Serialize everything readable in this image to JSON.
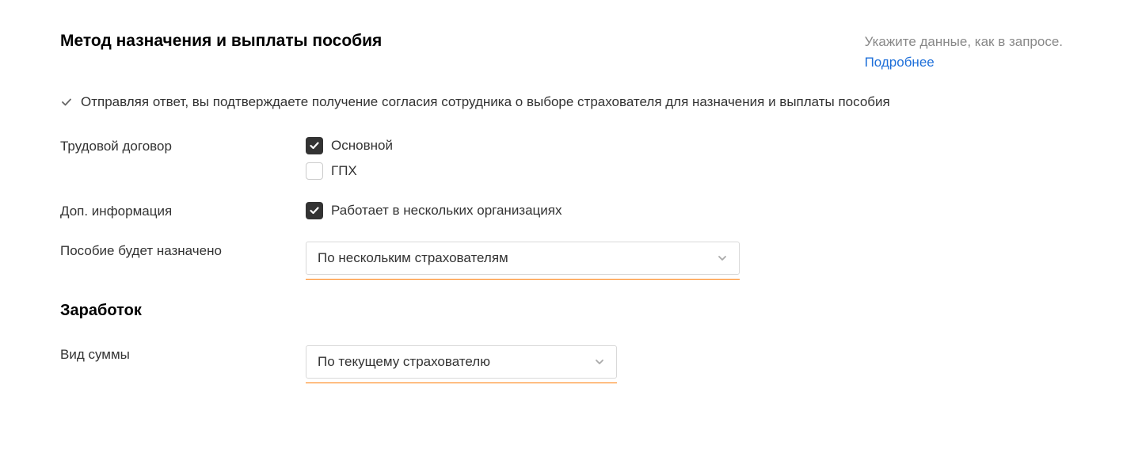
{
  "header": {
    "title": "Метод назначения и выплаты пособия",
    "hint": "Укажите данные, как в запросе.",
    "more": "Подробнее"
  },
  "consent_text": "Отправляя ответ, вы подтверждаете получение согласия сотрудника о выборе страхователя для назначения и выплаты пособия",
  "contract": {
    "label": "Трудовой договор",
    "opt_main": "Основной",
    "opt_gpx": "ГПХ"
  },
  "addinfo": {
    "label": "Доп. информация",
    "opt_multi": "Работает в нескольких организациях"
  },
  "assignment": {
    "label": "Пособие будет назначено",
    "value": "По нескольким страхователям"
  },
  "earnings_title": "Заработок",
  "amount": {
    "label": "Вид суммы",
    "value": "По текущему страхователю"
  }
}
